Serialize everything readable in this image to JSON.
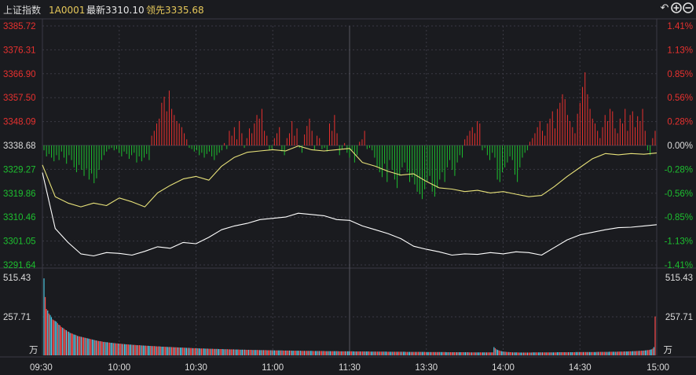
{
  "header": {
    "title": "上证指数",
    "code": "1A0001",
    "last_label": "最新3310.10",
    "lead_label": "领先3335.68",
    "icons": [
      "undo-icon",
      "zoom-in-icon",
      "zoom-out-icon"
    ]
  },
  "colors": {
    "background": "#1a1b1f",
    "up": "#e8312f",
    "down": "#1dbf2f",
    "neutral": "#dcdcdc",
    "price_line": "#ffffff",
    "lead_line": "#e8e27a",
    "volume_up": "#ff4d4d",
    "volume_down": "#4cc6e0",
    "grid": "#3a3a44"
  },
  "chart_data": {
    "type": "line",
    "title": "",
    "prev_close": 3338.68,
    "left_axis_ticks": [
      "3385.72",
      "3376.31",
      "3366.90",
      "3357.50",
      "3348.09",
      "3338.68",
      "3329.27",
      "3319.86",
      "3310.46",
      "3301.05",
      "3291.64"
    ],
    "right_axis_ticks": [
      "1.41%",
      "1.13%",
      "0.85%",
      "0.56%",
      "0.28%",
      "0.00%",
      "-0.28%",
      "-0.56%",
      "-0.85%",
      "-1.13%",
      "-1.41%"
    ],
    "ylim": [
      3291.64,
      3385.72
    ],
    "x_ticks": [
      "09:30",
      "10:00",
      "10:30",
      "11:00",
      "11:30",
      "13:30",
      "14:00",
      "14:30",
      "15:00"
    ],
    "volume_ticks": [
      "515.43",
      "257.71",
      "万"
    ],
    "volume_ylim": [
      0,
      515.43
    ],
    "series": [
      {
        "color": "#ffffff",
        "x": [
          "09:30",
          "09:35",
          "09:40",
          "09:45",
          "09:50",
          "09:55",
          "10:00",
          "10:05",
          "10:10",
          "10:15",
          "10:20",
          "10:25",
          "10:30",
          "10:35",
          "10:40",
          "10:45",
          "10:50",
          "10:55",
          "11:00",
          "11:05",
          "11:10",
          "11:15",
          "11:20",
          "11:25",
          "11:30",
          "13:05",
          "13:10",
          "13:15",
          "13:20",
          "13:25",
          "13:30",
          "13:35",
          "13:40",
          "13:45",
          "13:50",
          "13:55",
          "14:00",
          "14:05",
          "14:10",
          "14:15",
          "14:20",
          "14:25",
          "14:30",
          "14:35",
          "14:40",
          "14:45",
          "14:50",
          "14:55",
          "15:00"
        ],
        "values": [
          3328.0,
          3306.0,
          3300.5,
          3296.0,
          3295.2,
          3296.5,
          3296.2,
          3295.5,
          3297.0,
          3298.8,
          3298.2,
          3300.5,
          3300.0,
          3302.5,
          3305.5,
          3307.0,
          3308.0,
          3309.5,
          3310.0,
          3310.5,
          3312.0,
          3311.5,
          3311.0,
          3309.5,
          3309.2,
          3307.0,
          3305.5,
          3304.0,
          3302.0,
          3299.0,
          3297.8,
          3296.8,
          3295.5,
          3296.0,
          3295.8,
          3296.5,
          3296.0,
          3296.8,
          3296.5,
          3295.5,
          3298.5,
          3301.5,
          3303.5,
          3304.5,
          3305.5,
          3306.3,
          3306.5,
          3307.0,
          3307.5
        ]
      },
      {
        "color": "#e8e27a",
        "x": [
          "09:30",
          "09:35",
          "09:40",
          "09:45",
          "09:50",
          "09:55",
          "10:00",
          "10:05",
          "10:10",
          "10:15",
          "10:20",
          "10:25",
          "10:30",
          "10:35",
          "10:40",
          "10:45",
          "10:50",
          "10:55",
          "11:00",
          "11:05",
          "11:10",
          "11:15",
          "11:20",
          "11:25",
          "11:30",
          "13:05",
          "13:10",
          "13:15",
          "13:20",
          "13:25",
          "13:30",
          "13:35",
          "13:40",
          "13:45",
          "13:50",
          "13:55",
          "14:00",
          "14:05",
          "14:10",
          "14:15",
          "14:20",
          "14:25",
          "14:30",
          "14:35",
          "14:40",
          "14:45",
          "14:50",
          "14:55",
          "15:00"
        ],
        "values": [
          3331.0,
          3318.5,
          3316.0,
          3314.5,
          3316.0,
          3315.0,
          3318.0,
          3316.5,
          3314.5,
          3320.0,
          3323.0,
          3325.5,
          3326.5,
          3325.0,
          3330.5,
          3334.0,
          3336.0,
          3336.5,
          3337.0,
          3336.5,
          3338.5,
          3337.0,
          3336.5,
          3337.0,
          3337.5,
          3332.0,
          3330.5,
          3328.5,
          3327.0,
          3327.5,
          3324.5,
          3322.0,
          3321.5,
          3320.5,
          3321.0,
          3320.0,
          3320.5,
          3319.5,
          3318.5,
          3319.0,
          3322.5,
          3326.5,
          3330.0,
          3333.5,
          3335.5,
          3335.0,
          3335.5,
          3335.2,
          3335.7
        ]
      }
    ],
    "breadth_bars": [
      -4,
      -9,
      -7,
      -10,
      -13,
      -8,
      -12,
      -5,
      -10,
      -15,
      -8,
      -12,
      -18,
      -22,
      -16,
      -20,
      -25,
      -19,
      -28,
      -23,
      -31,
      -27,
      -20,
      -12,
      -8,
      -5,
      -3,
      -2,
      -4,
      -3,
      -6,
      -9,
      -5,
      -7,
      -11,
      -8,
      -6,
      -14,
      -9,
      -13,
      -10,
      -7,
      -12,
      8,
      12,
      18,
      22,
      35,
      40,
      28,
      45,
      30,
      25,
      20,
      18,
      15,
      10,
      5,
      -2,
      -3,
      -5,
      -4,
      -8,
      -6,
      -10,
      -7,
      -5,
      -9,
      -12,
      -8,
      -6,
      -4,
      2,
      -3,
      12,
      8,
      15,
      5,
      20,
      10,
      -2,
      6,
      14,
      10,
      18,
      25,
      22,
      30,
      12,
      8,
      -4,
      -3,
      6,
      10,
      15,
      -5,
      -8,
      6,
      10,
      20,
      8,
      14,
      -2,
      -6,
      9,
      16,
      22,
      12,
      -4,
      8,
      6,
      -3,
      -2,
      -5,
      18,
      12,
      25,
      10,
      -8,
      -3,
      2,
      -6,
      -10,
      -4,
      -14,
      -8,
      3,
      5,
      12,
      -3,
      -2,
      -4,
      -10,
      -18,
      -22,
      -26,
      -15,
      -30,
      -12,
      -20,
      -28,
      -35,
      -25,
      -18,
      -14,
      -22,
      -30,
      -26,
      -32,
      -38,
      -40,
      -44,
      -36,
      -30,
      -25,
      -38,
      -42,
      -35,
      -28,
      -22,
      -30,
      -18,
      -12,
      -20,
      -25,
      -14,
      -8,
      -10,
      5,
      8,
      12,
      15,
      10,
      20,
      18,
      -4,
      -2,
      -8,
      -12,
      -6,
      -10,
      -28,
      -30,
      -22,
      -18,
      -14,
      -9,
      -12,
      -24,
      -30,
      -18,
      -10,
      -6,
      -4,
      3,
      6,
      10,
      15,
      20,
      12,
      8,
      18,
      22,
      28,
      14,
      30,
      35,
      42,
      38,
      25,
      20,
      15,
      10,
      26,
      35,
      48,
      60,
      42,
      30,
      22,
      18,
      12,
      6,
      15,
      25,
      20,
      30,
      28,
      14,
      10,
      22,
      18,
      30,
      12,
      25,
      28,
      15,
      24,
      20,
      30,
      12,
      -4,
      -8,
      6,
      12
    ],
    "volume_bars": [
      515,
      390,
      310,
      300,
      280,
      270,
      255,
      240,
      235,
      230,
      225,
      215,
      205,
      200,
      190,
      185,
      180,
      172,
      168,
      160,
      158,
      150,
      148,
      145,
      140,
      138,
      135,
      130,
      128,
      126,
      124,
      122,
      120,
      118,
      116,
      114,
      112,
      110,
      108,
      106,
      104,
      102,
      100,
      98,
      96,
      95,
      94,
      92,
      90,
      90,
      88,
      88,
      86,
      85,
      84,
      84,
      82,
      82,
      80,
      80,
      79,
      78,
      78,
      76,
      76,
      75,
      74,
      74,
      73,
      72,
      72,
      71,
      70,
      70,
      69,
      68,
      68,
      68,
      67,
      66,
      66,
      65,
      65,
      64,
      64,
      63,
      63,
      62,
      62,
      62,
      61,
      60,
      60,
      60,
      59,
      58,
      58,
      58,
      57,
      57,
      56,
      56,
      56,
      55,
      55,
      54,
      54,
      54,
      53,
      53,
      52,
      52,
      52,
      51,
      51,
      50,
      50,
      50,
      49,
      49,
      48,
      48,
      48,
      48,
      47,
      47,
      46,
      46,
      46,
      46,
      45,
      45,
      45,
      44,
      44,
      44,
      44,
      43,
      43,
      43,
      43,
      42,
      42,
      42,
      42,
      41,
      41,
      41,
      41,
      40,
      40,
      40,
      40,
      40,
      39,
      39,
      39,
      39,
      38,
      38,
      38,
      38,
      38,
      37,
      37,
      37,
      37,
      37,
      36,
      36,
      36,
      36,
      36,
      36,
      35,
      35,
      35,
      35,
      35,
      35,
      34,
      34,
      34,
      34,
      34,
      34,
      33,
      33,
      33,
      33,
      33,
      33,
      33,
      32,
      32,
      32,
      32,
      32,
      32,
      32,
      31,
      31,
      31,
      31,
      31,
      31,
      31,
      31,
      30,
      30,
      30,
      30,
      30,
      30,
      30,
      30,
      30,
      29,
      29,
      29,
      29,
      29,
      29,
      29,
      29,
      29,
      29,
      28,
      28,
      28,
      28,
      28,
      28,
      28,
      28,
      28,
      28,
      28,
      27,
      27,
      27,
      27,
      27,
      27,
      27,
      27,
      27,
      27,
      27,
      27,
      26,
      26,
      26,
      26,
      26,
      26,
      26,
      26,
      26,
      26,
      26,
      26,
      26,
      25,
      25,
      25,
      25,
      25,
      25,
      25,
      25,
      25,
      25,
      25,
      25,
      25,
      25,
      24,
      24,
      24,
      24,
      24,
      24,
      24,
      24,
      24,
      24,
      24,
      24,
      24,
      24,
      24,
      23,
      23,
      23,
      23,
      23,
      23,
      23,
      23,
      23,
      23,
      23,
      23,
      23,
      23,
      23,
      23,
      22,
      22,
      22,
      22,
      22,
      22,
      22,
      22,
      22,
      22,
      22,
      22,
      22,
      22,
      22,
      22,
      22,
      21,
      21,
      21,
      21,
      21,
      21,
      21,
      21,
      21,
      21,
      21,
      21,
      21,
      21,
      21,
      21,
      21,
      21,
      20,
      20,
      20,
      20,
      20,
      20,
      20,
      20,
      20,
      20,
      20,
      20,
      20,
      20,
      20,
      20,
      20,
      20,
      20,
      20,
      55,
      48,
      40,
      36,
      33,
      30,
      28,
      26,
      25,
      24,
      23,
      22,
      22,
      21,
      21,
      20,
      20,
      20,
      20,
      20,
      19,
      19,
      19,
      19,
      19,
      19,
      19,
      19,
      19,
      19,
      19,
      20,
      20,
      20,
      20,
      20,
      20,
      20,
      20,
      20,
      20,
      20,
      20,
      20,
      20,
      20,
      20,
      20,
      20,
      20,
      20,
      21,
      21,
      21,
      21,
      21,
      21,
      21,
      21,
      21,
      21,
      21,
      21,
      21,
      21,
      21,
      22,
      22,
      22,
      22,
      22,
      22,
      22,
      22,
      22,
      22,
      22,
      22,
      22,
      22,
      22,
      22,
      22,
      23,
      23,
      23,
      23,
      23,
      23,
      23,
      23,
      23,
      23,
      24,
      24,
      24,
      24,
      24,
      24,
      24,
      25,
      25,
      25,
      25,
      25,
      26,
      26,
      26,
      26,
      27,
      27,
      27,
      28,
      28,
      28,
      29,
      29,
      30,
      30,
      31,
      31,
      32,
      33,
      34,
      35,
      36,
      38,
      40,
      45,
      55,
      260
    ]
  }
}
